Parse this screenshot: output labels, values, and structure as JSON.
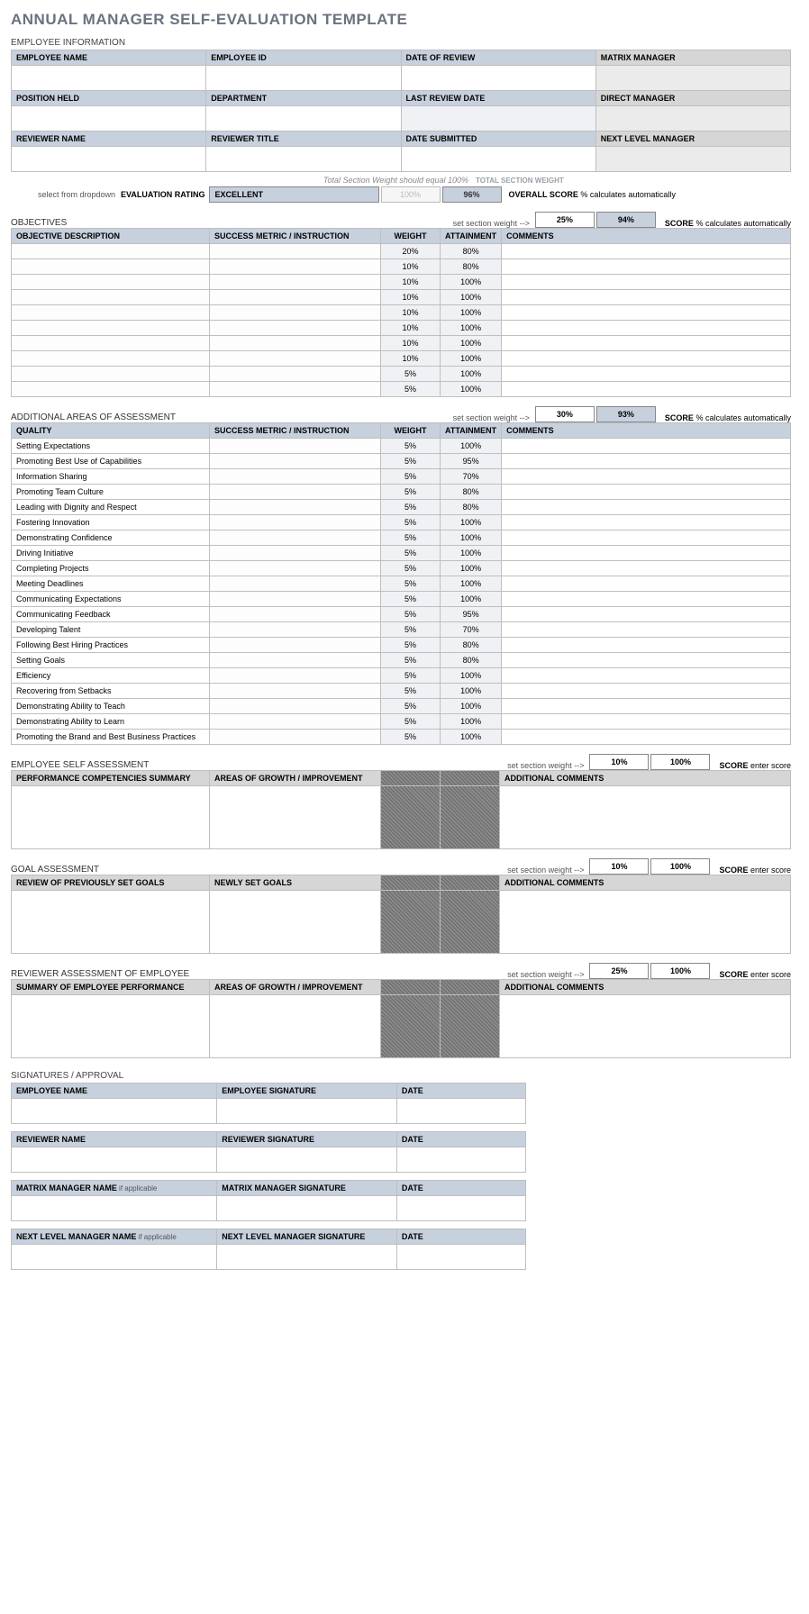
{
  "title": "ANNUAL MANAGER SELF-EVALUATION TEMPLATE",
  "empInfo": {
    "section": "EMPLOYEE INFORMATION",
    "h": {
      "empName": "EMPLOYEE NAME",
      "empId": "EMPLOYEE ID",
      "dateReview": "DATE OF REVIEW",
      "matrix": "MATRIX MANAGER",
      "pos": "POSITION HELD",
      "dept": "DEPARTMENT",
      "lastRev": "LAST REVIEW DATE",
      "direct": "DIRECT MANAGER",
      "revName": "REVIEWER NAME",
      "revTitle": "REVIEWER TITLE",
      "dateSub": "DATE SUBMITTED",
      "nextLvl": "NEXT LEVEL MANAGER"
    }
  },
  "totals": {
    "hint": "Total Section Weight should equal 100%",
    "tswLabel": "TOTAL SECTION WEIGHT",
    "selectHint": "select from dropdown",
    "evalLabel": "EVALUATION RATING",
    "rating": "EXCELLENT",
    "pct100": "100%",
    "pctScore": "96%",
    "overallBold": "OVERALL SCORE",
    "overallRest": " % calculates automatically"
  },
  "objectives": {
    "section": "OBJECTIVES",
    "setHint": "set section weight -->",
    "weight": "25%",
    "attain": "94%",
    "scoreBold": "SCORE",
    "scoreRest": " % calculates automatically",
    "h": {
      "desc": "OBJECTIVE DESCRIPTION",
      "metric": "SUCCESS METRIC / INSTRUCTION",
      "w": "WEIGHT",
      "a": "ATTAINMENT",
      "c": "COMMENTS"
    },
    "rows": [
      {
        "w": "20%",
        "a": "80%"
      },
      {
        "w": "10%",
        "a": "80%"
      },
      {
        "w": "10%",
        "a": "100%"
      },
      {
        "w": "10%",
        "a": "100%"
      },
      {
        "w": "10%",
        "a": "100%"
      },
      {
        "w": "10%",
        "a": "100%"
      },
      {
        "w": "10%",
        "a": "100%"
      },
      {
        "w": "10%",
        "a": "100%"
      },
      {
        "w": "5%",
        "a": "100%"
      },
      {
        "w": "5%",
        "a": "100%"
      }
    ]
  },
  "additional": {
    "section": "ADDITIONAL AREAS OF ASSESSMENT",
    "setHint": "set section weight -->",
    "weight": "30%",
    "attain": "93%",
    "scoreBold": "SCORE",
    "scoreRest": " % calculates automatically",
    "h": {
      "q": "QUALITY",
      "metric": "SUCCESS METRIC / INSTRUCTION",
      "w": "WEIGHT",
      "a": "ATTAINMENT",
      "c": "COMMENTS"
    },
    "rows": [
      {
        "q": "Setting Expectations",
        "w": "5%",
        "a": "100%"
      },
      {
        "q": "Promoting Best Use of Capabilities",
        "w": "5%",
        "a": "95%"
      },
      {
        "q": "Information Sharing",
        "w": "5%",
        "a": "70%"
      },
      {
        "q": "Promoting Team Culture",
        "w": "5%",
        "a": "80%"
      },
      {
        "q": "Leading with Dignity and Respect",
        "w": "5%",
        "a": "80%"
      },
      {
        "q": "Fostering Innovation",
        "w": "5%",
        "a": "100%"
      },
      {
        "q": "Demonstrating Confidence",
        "w": "5%",
        "a": "100%"
      },
      {
        "q": "Driving Initiative",
        "w": "5%",
        "a": "100%"
      },
      {
        "q": "Completing Projects",
        "w": "5%",
        "a": "100%"
      },
      {
        "q": "Meeting Deadlines",
        "w": "5%",
        "a": "100%"
      },
      {
        "q": "Communicating Expectations",
        "w": "5%",
        "a": "100%"
      },
      {
        "q": "Communicating Feedback",
        "w": "5%",
        "a": "95%"
      },
      {
        "q": "Developing Talent",
        "w": "5%",
        "a": "70%"
      },
      {
        "q": "Following Best Hiring Practices",
        "w": "5%",
        "a": "80%"
      },
      {
        "q": "Setting Goals",
        "w": "5%",
        "a": "80%"
      },
      {
        "q": "Efficiency",
        "w": "5%",
        "a": "100%"
      },
      {
        "q": "Recovering from Setbacks",
        "w": "5%",
        "a": "100%"
      },
      {
        "q": "Demonstrating Ability to Teach",
        "w": "5%",
        "a": "100%"
      },
      {
        "q": "Demonstrating Ability to Learn",
        "w": "5%",
        "a": "100%"
      },
      {
        "q": "Promoting the Brand and Best Business Practices",
        "w": "5%",
        "a": "100%"
      }
    ]
  },
  "selfAssess": {
    "section": "EMPLOYEE SELF ASSESSMENT",
    "setHint": "set section weight -->",
    "weight": "10%",
    "attain": "100%",
    "scoreBold": "SCORE",
    "scoreRest": " enter score",
    "h": {
      "a": "PERFORMANCE COMPETENCIES SUMMARY",
      "b": "AREAS OF GROWTH / IMPROVEMENT",
      "c": "ADDITIONAL COMMENTS"
    }
  },
  "goalAssess": {
    "section": "GOAL ASSESSMENT",
    "setHint": "set section weight -->",
    "weight": "10%",
    "attain": "100%",
    "scoreBold": "SCORE",
    "scoreRest": " enter score",
    "h": {
      "a": "REVIEW OF PREVIOUSLY SET GOALS",
      "b": "NEWLY SET GOALS",
      "c": "ADDITIONAL COMMENTS"
    }
  },
  "revAssess": {
    "section": "REVIEWER ASSESSMENT OF EMPLOYEE",
    "setHint": "set section weight -->",
    "weight": "25%",
    "attain": "100%",
    "scoreBold": "SCORE",
    "scoreRest": " enter score",
    "h": {
      "a": "SUMMARY OF EMPLOYEE PERFORMANCE",
      "b": "AREAS OF GROWTH / IMPROVEMENT",
      "c": "ADDITIONAL COMMENTS"
    }
  },
  "sig": {
    "section": "SIGNATURES / APPROVAL",
    "ifapp": " if applicable",
    "rows": [
      {
        "n": "EMPLOYEE NAME",
        "s": "EMPLOYEE SIGNATURE",
        "d": "DATE"
      },
      {
        "n": "REVIEWER NAME",
        "s": "REVIEWER SIGNATURE",
        "d": "DATE"
      },
      {
        "n": "MATRIX MANAGER NAME",
        "s": "MATRIX MANAGER SIGNATURE",
        "d": "DATE"
      },
      {
        "n": "NEXT LEVEL MANAGER NAME",
        "s": "NEXT LEVEL MANAGER SIGNATURE",
        "d": "DATE"
      }
    ]
  }
}
